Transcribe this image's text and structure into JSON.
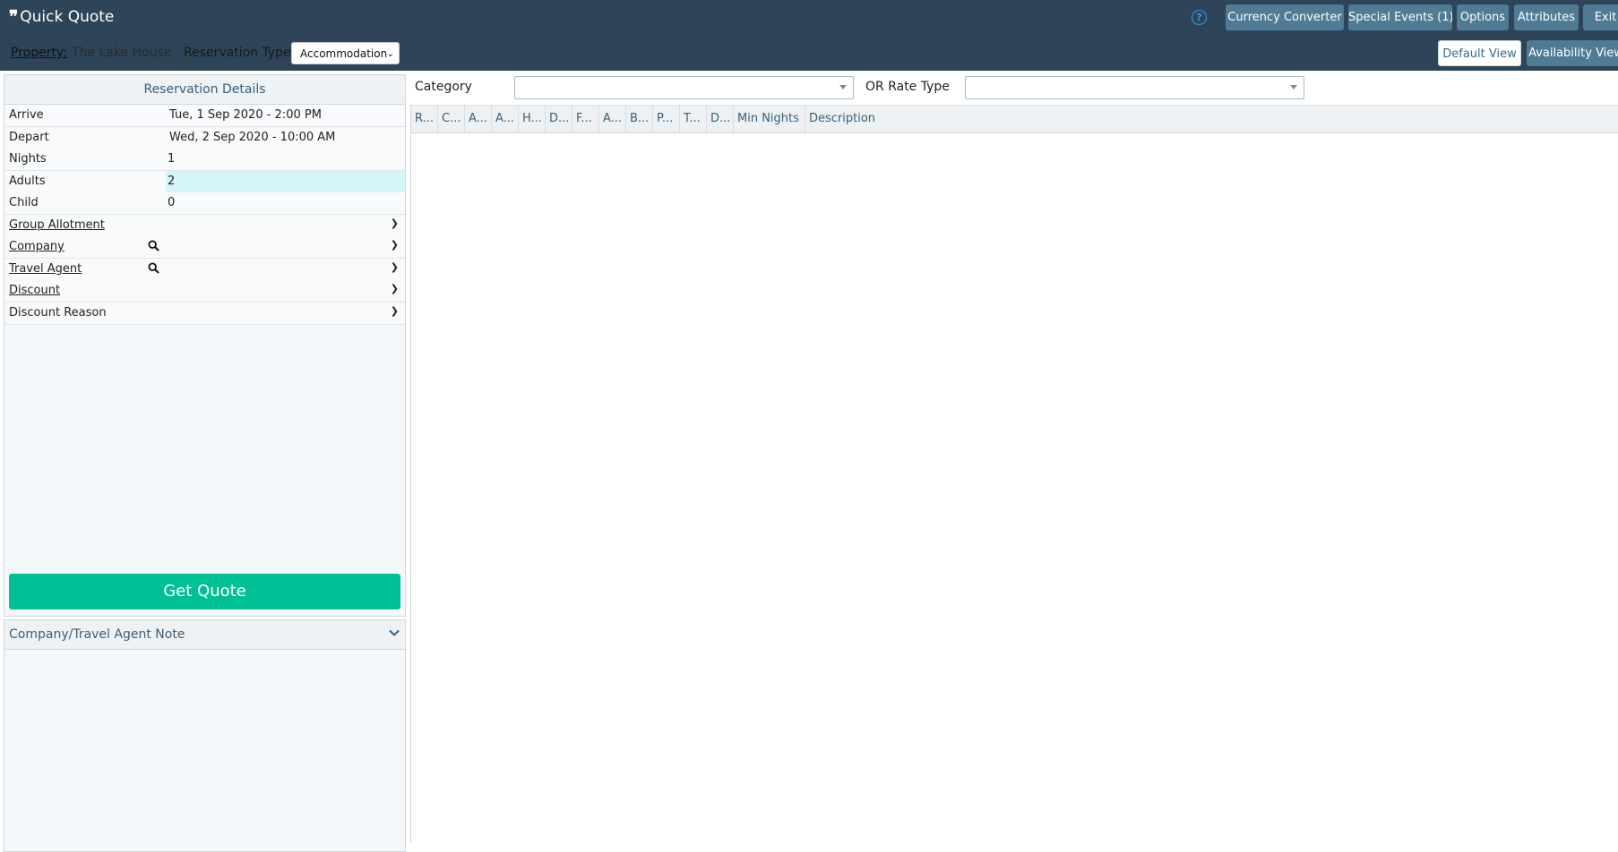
{
  "app": {
    "title": "Quick Quote"
  },
  "toolbar": {
    "currency_converter": "Currency Converter",
    "special_events": "Special Events (1)",
    "options": "Options",
    "attributes": "Attributes",
    "exit": "Exit",
    "help_glyph": "?"
  },
  "subheader": {
    "property_label": "Property:",
    "property_value": "The Lake House",
    "reservation_type_label": "Reservation Type:",
    "reservation_type_value": "Accommodation",
    "default_view": "Default View",
    "availability_view": "Availability View"
  },
  "reservation": {
    "header": "Reservation Details",
    "arrive_label": "Arrive",
    "arrive_value": "Tue, 1 Sep 2020 - 2:00 PM",
    "depart_label": "Depart",
    "depart_value": "Wed, 2 Sep 2020 - 10:00 AM",
    "nights_label": "Nights",
    "nights_value": "1",
    "adults_label": "Adults",
    "adults_value": "2",
    "child_label": "Child",
    "child_value": "0",
    "group_allotment_label": "Group Allotment",
    "company_label": "Company",
    "travel_agent_label": "Travel Agent",
    "discount_label": "Discount",
    "discount_reason_label": "Discount Reason",
    "get_quote": "Get Quote"
  },
  "note": {
    "header": "Company/Travel Agent Note"
  },
  "filters": {
    "category_label": "Category",
    "rate_type_label": "OR Rate Type"
  },
  "grid": {
    "columns": [
      "R...",
      "C...",
      "A...",
      "A...",
      "H...",
      "D...",
      "F...",
      "A...",
      "B...",
      "P...",
      "T...",
      "D...",
      "Min Nights",
      "Description"
    ]
  },
  "colors": {
    "topbar": "#2d4459",
    "button": "#4f7b95",
    "accent": "#00c196",
    "highlight": "#d5f5f9"
  }
}
